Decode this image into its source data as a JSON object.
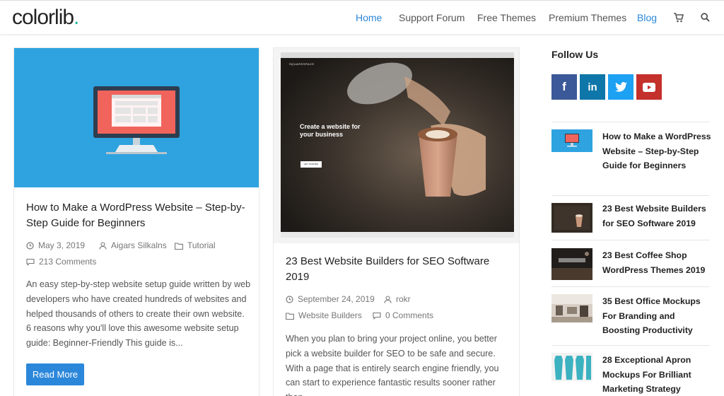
{
  "header": {
    "logo": "colorlib",
    "logo_dot": ".",
    "nav": [
      "Home",
      "Support Forum",
      "Free Themes",
      "Premium Themes",
      "Blog"
    ],
    "icons": [
      "cart-icon",
      "search-icon"
    ],
    "accent_color": "#2b87da",
    "brand_dot_color": "#1bbc9b"
  },
  "posts": [
    {
      "title": "How to Make a WordPress Website – Step-by-Step Guide for Beginners",
      "date": "May 3, 2019",
      "author": "Aigars Silkalns",
      "category": "Tutorial",
      "comments": "213 Comments",
      "excerpt": "An easy step-by-step website setup guide written by web developers who have created hundreds of websites and helped thousands of others to create their own website. 6 reasons why you'll love this awesome website setup guide: Beginner-Friendly This guide is...",
      "read_more": "Read More"
    },
    {
      "title": "23 Best Website Builders for SEO Software 2019",
      "date": "September 24, 2019",
      "author": "rokr",
      "category": "Website Builders",
      "comments": "0 Comments",
      "excerpt": "When you plan to bring your project online, you better pick a website builder for SEO to be safe and secure. With a page that is entirely search engine friendly, you can start to experience fantastic results sooner rather than...",
      "thumb": {
        "brand": "SQUARESPACE",
        "hero_line1": "Create a website for",
        "hero_line2": "your business",
        "cta": "GET STARTED"
      }
    }
  ],
  "sidebar": {
    "follow_title": "Follow Us",
    "social": [
      "f",
      "in"
    ],
    "items": [
      "How to Make a WordPress Website – Step-by-Step Guide for Beginners",
      "23 Best Website Builders for SEO Software 2019",
      "23 Best Coffee Shop WordPress Themes 2019",
      "35 Best Office Mockups For Branding and Boosting Productivity",
      "28 Exceptional Apron Mockups For Brilliant Marketing Strategy"
    ]
  }
}
